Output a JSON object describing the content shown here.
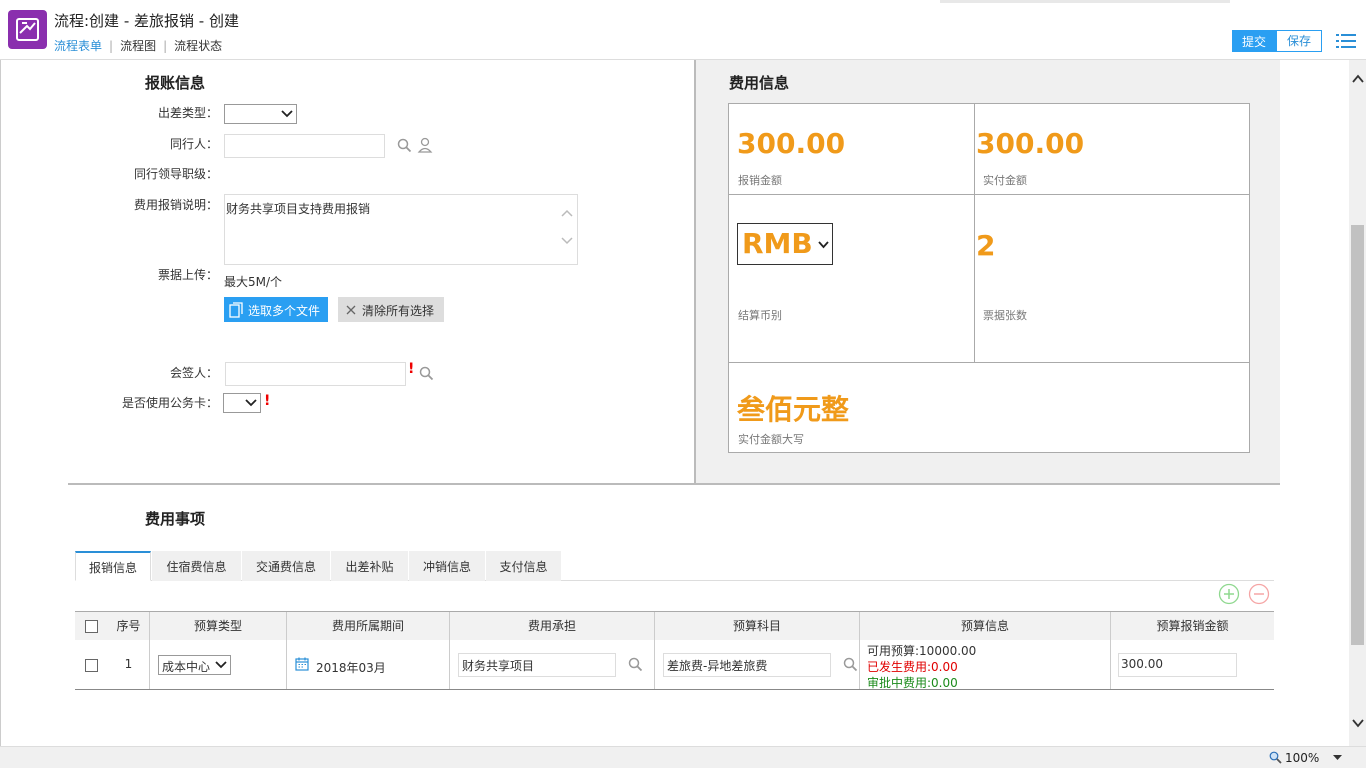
{
  "header": {
    "title": "流程:创建 - 差旅报销 - 创建",
    "nav": [
      "流程表单",
      "流程图",
      "流程状态"
    ],
    "submit_label": "提交",
    "save_label": "保存"
  },
  "claim_info": {
    "heading": "报账信息",
    "trip_type_label": "出差类型：",
    "companion_label": "同行人：",
    "companion_leader_label": "同行领导职级：",
    "description_label": "费用报销说明：",
    "description_value": "财务共享项目支持费用报销",
    "upload_label": "票据上传：",
    "upload_limit": "最大5M/个",
    "select_files_label": "选取多个文件",
    "clear_selection_label": "清除所有选择",
    "countersigner_label": "会签人：",
    "corporate_card_label": "是否使用公务卡：",
    "required_mark": "!"
  },
  "fee_info": {
    "heading": "费用信息",
    "claim_amount": "300.00",
    "claim_amount_label": "报销金额",
    "paid_amount": "300.00",
    "paid_amount_label": "实付金额",
    "currency": "RMB",
    "currency_label": "结算币别",
    "receipt_count": "2",
    "receipt_count_label": "票据张数",
    "amount_in_words": "叁佰元整",
    "amount_in_words_label": "实付金额大写"
  },
  "expense_items": {
    "heading": "费用事项",
    "tabs": [
      "报销信息",
      "住宿费信息",
      "交通费信息",
      "出差补贴",
      "冲销信息",
      "支付信息"
    ],
    "columns": [
      "序号",
      "预算类型",
      "费用所属期间",
      "费用承担",
      "预算科目",
      "预算信息",
      "预算报销金额"
    ],
    "rows": [
      {
        "index": "1",
        "budget_type": "成本中心",
        "period": "2018年03月",
        "bearer": "财务共享项目",
        "subject": "差旅费-异地差旅费",
        "available_budget": "可用预算:10000.00",
        "incurred_cost": "已发生费用:0.00",
        "pending_cost": "审批中费用:0.00",
        "amount": "300.00"
      }
    ]
  },
  "status_bar": {
    "zoom": "100%"
  },
  "colors": {
    "accent_blue": "#2a9ff2",
    "amount_orange": "#f09a1a",
    "required_red": "#e00000",
    "incurred_red": "#e00000",
    "pending_green": "#1a8a1a",
    "logo_purple": "#8a2fae"
  },
  "icons": [
    "flow-logo-icon",
    "search-icon",
    "person-icon",
    "file-icon",
    "close-icon",
    "calendar-icon",
    "plus-circle-icon",
    "minus-circle-icon",
    "menu-icon",
    "zoom-icon",
    "chevron-down-icon",
    "scroll-up-icon",
    "scroll-down-icon"
  ]
}
